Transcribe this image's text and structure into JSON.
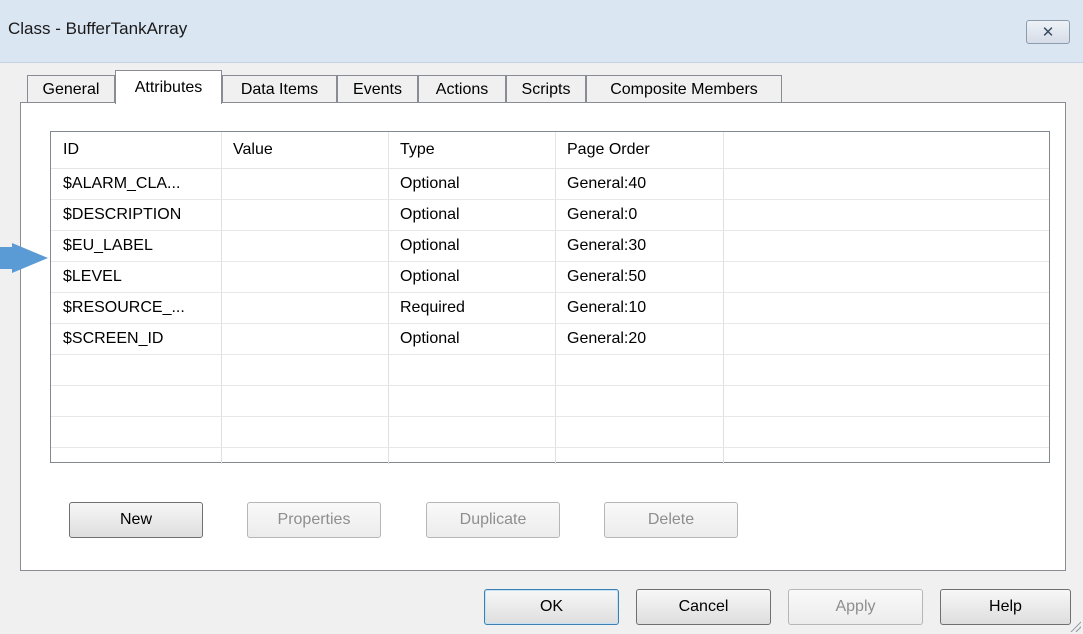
{
  "window": {
    "title": "Class - BufferTankArray",
    "close_glyph": "✕"
  },
  "tabs": [
    {
      "label": "General",
      "active": false
    },
    {
      "label": "Attributes",
      "active": true
    },
    {
      "label": "Data Items",
      "active": false
    },
    {
      "label": "Events",
      "active": false
    },
    {
      "label": "Actions",
      "active": false
    },
    {
      "label": "Scripts",
      "active": false
    },
    {
      "label": "Composite Members",
      "active": false
    }
  ],
  "table": {
    "columns": [
      "ID",
      "Value",
      "Type",
      "Page Order"
    ],
    "rows": [
      {
        "id": "$ALARM_CLA...",
        "value": "",
        "type": "Optional",
        "page_order": "General:40"
      },
      {
        "id": "$DESCRIPTION",
        "value": "",
        "type": "Optional",
        "page_order": "General:0"
      },
      {
        "id": "$EU_LABEL",
        "value": "",
        "type": "Optional",
        "page_order": "General:30"
      },
      {
        "id": "$LEVEL",
        "value": "",
        "type": "Optional",
        "page_order": "General:50"
      },
      {
        "id": "$RESOURCE_...",
        "value": "",
        "type": "Required",
        "page_order": "General:10"
      },
      {
        "id": "$SCREEN_ID",
        "value": "",
        "type": "Optional",
        "page_order": "General:20"
      }
    ]
  },
  "panel_buttons": {
    "new": "New",
    "properties": "Properties",
    "duplicate": "Duplicate",
    "delete": "Delete"
  },
  "dialog_buttons": {
    "ok": "OK",
    "cancel": "Cancel",
    "apply": "Apply",
    "help": "Help"
  },
  "colors": {
    "pointer": "#5b9bd5",
    "titlebar": "#dbe6f3"
  }
}
